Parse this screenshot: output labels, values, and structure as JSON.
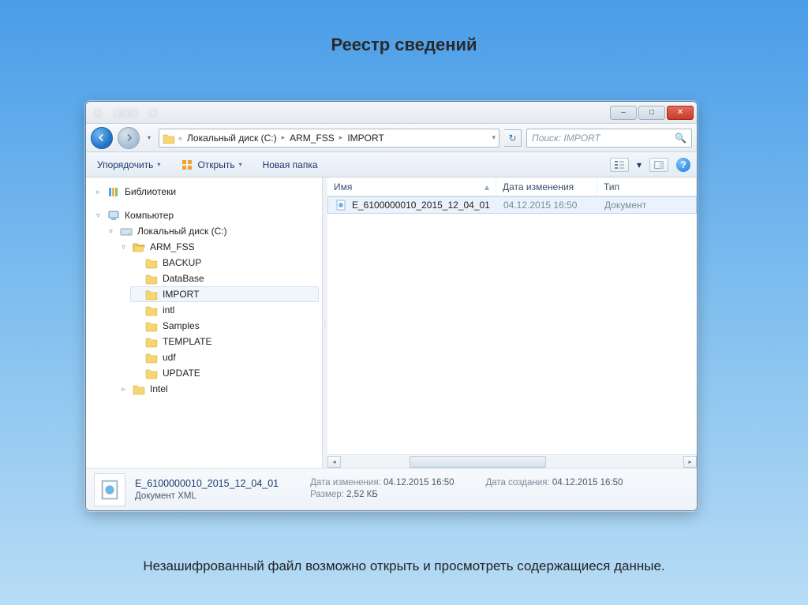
{
  "slide": {
    "title": "Реестр сведений",
    "caption": "Незашифрованный файл возможно открыть и просмотреть содержащиеся данные."
  },
  "window": {
    "controls": {
      "min": "–",
      "max": "□",
      "close": "✕"
    }
  },
  "address": {
    "chevrons": "«",
    "crumb1": "Локальный диск (C:)",
    "crumb2": "ARM_FSS",
    "crumb3": "IMPORT",
    "sep": "▸",
    "dropdown": "▾",
    "refresh": "↻"
  },
  "search": {
    "placeholder": "Поиск: IMPORT",
    "icon": "🔍"
  },
  "toolbar": {
    "organize": "Упорядочить",
    "open": "Открыть",
    "newfolder": "Новая папка",
    "dd": "▾",
    "help": "?"
  },
  "tree": {
    "libraries": "Библиотеки",
    "computer": "Компьютер",
    "localdisk": "Локальный диск (C:)",
    "arm": "ARM_FSS",
    "backup": "BACKUP",
    "database": "DataBase",
    "import": "IMPORT",
    "intl": "intl",
    "samples": "Samples",
    "template": "TEMPLATE",
    "udf": "udf",
    "update": "UPDATE",
    "intel": "Intel",
    "exp_open": "▿",
    "exp_closed": "▹"
  },
  "columns": {
    "name": "Имя",
    "date": "Дата изменения",
    "type": "Тип",
    "sort": "▴"
  },
  "file": {
    "name": "E_6100000010_2015_12_04_01",
    "date": "04.12.2015 16:50",
    "type": "Документ"
  },
  "details": {
    "filename": "E_6100000010_2015_12_04_01",
    "subtype": "Документ XML",
    "mod_label": "Дата изменения:",
    "mod_value": "04.12.2015 16:50",
    "size_label": "Размер:",
    "size_value": "2,52 КБ",
    "created_label": "Дата создания:",
    "created_value": "04.12.2015 16:50"
  }
}
